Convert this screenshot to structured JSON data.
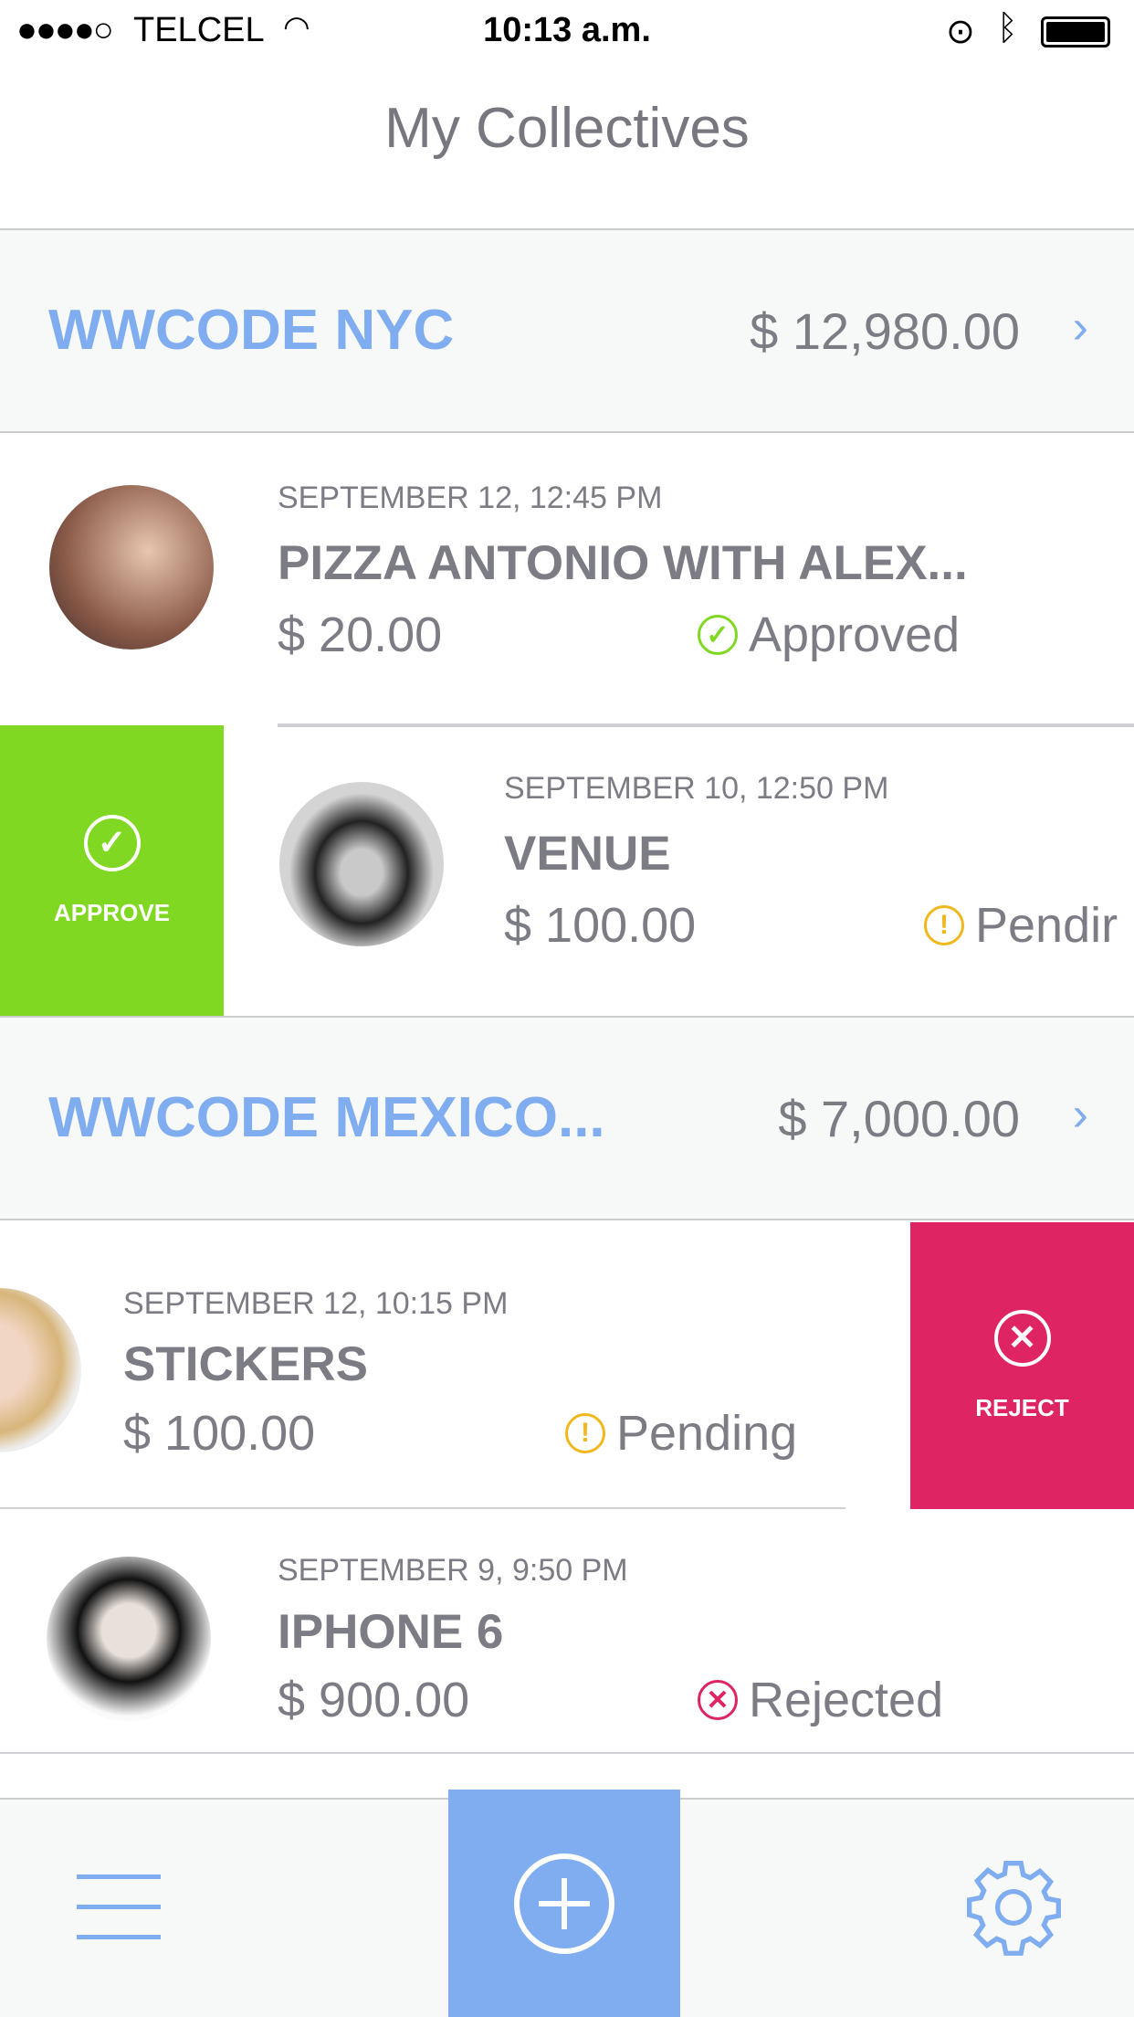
{
  "status_bar": {
    "carrier": "TELCEL",
    "time": "10:13 a.m."
  },
  "header": {
    "title": "My Collectives"
  },
  "collectives": [
    {
      "name": "WWCODE NYC",
      "balance": "$ 12,980.00"
    },
    {
      "name": "WWCODE MEXICO...",
      "balance": "$ 7,000.00"
    }
  ],
  "expenses": [
    {
      "date": "SEPTEMBER 12, 12:45 PM",
      "title": "PIZZA ANTONIO WITH ALEX...",
      "amount": "$ 20.00",
      "status": "Approved"
    },
    {
      "date": "SEPTEMBER 10, 12:50 PM",
      "title": "VENUE",
      "amount": "$ 100.00",
      "status": "Pendir"
    },
    {
      "date": "SEPTEMBER 12, 10:15 PM",
      "title": "STICKERS",
      "amount": "$ 100.00",
      "status": "Pending"
    },
    {
      "date": "SEPTEMBER 9, 9:50 PM",
      "title": "IPHONE 6",
      "amount": "$ 900.00",
      "status": "Rejected"
    }
  ],
  "actions": {
    "approve": "APPROVE",
    "reject": "REJECT"
  },
  "colors": {
    "accent": "#7fadf0",
    "approve": "#80d823",
    "reject": "#de2462",
    "pending": "#f0b81e"
  },
  "tabbar": {
    "icons": [
      "menu-icon",
      "add-icon",
      "gear-icon"
    ]
  }
}
